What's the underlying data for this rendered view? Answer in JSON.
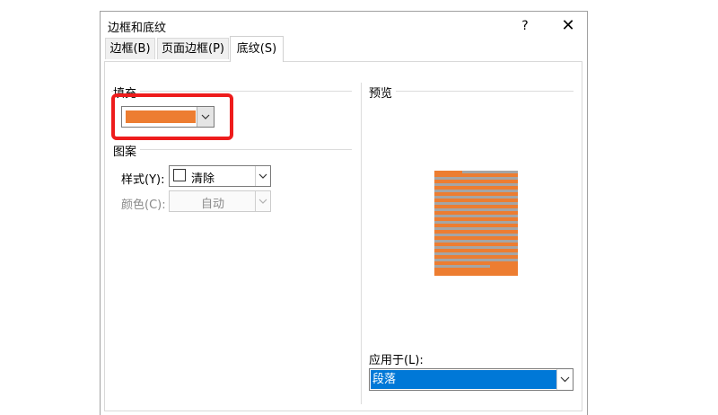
{
  "dialog": {
    "title": "边框和底纹",
    "help_label": "?",
    "close_label": "✕"
  },
  "tabs": [
    {
      "label": "边框(B)",
      "active": false
    },
    {
      "label": "页面边框(P)",
      "active": false
    },
    {
      "label": "底纹(S)",
      "active": true
    }
  ],
  "fill": {
    "label": "填充",
    "color": "#ED7D31"
  },
  "pattern": {
    "label": "图案",
    "style_label": "样式(Y):",
    "style_value": "清除",
    "color_label": "颜色(C):",
    "color_value": "自动"
  },
  "preview": {
    "label": "预览"
  },
  "apply": {
    "label": "应用于(L):",
    "value": "段落"
  },
  "colors": {
    "highlight": "#EE1C1C",
    "selection": "#0078D7"
  }
}
